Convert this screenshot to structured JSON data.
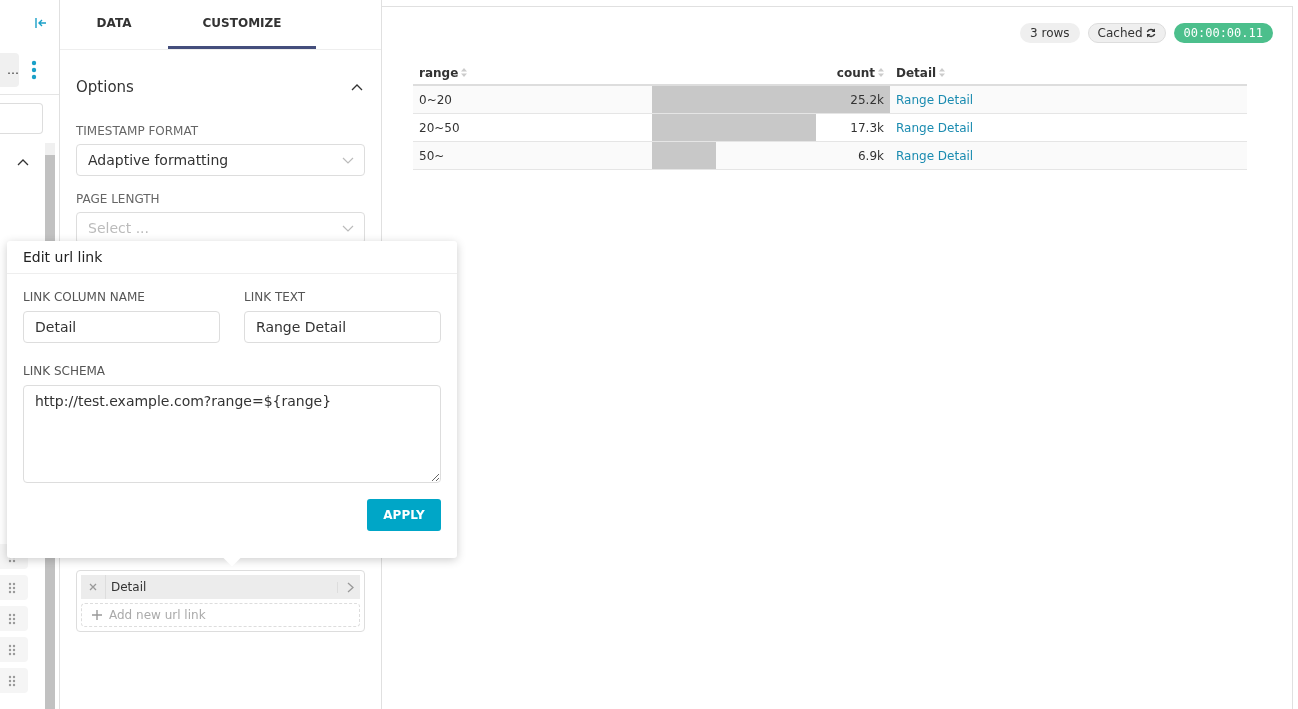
{
  "sidebar": {
    "menu_button": "…"
  },
  "panel": {
    "tabs": [
      {
        "label": "DATA",
        "selected": false
      },
      {
        "label": "CUSTOMIZE",
        "selected": true
      }
    ],
    "section": {
      "title": "Options",
      "expanded": true
    },
    "timestamp_format": {
      "label": "TIMESTAMP FORMAT",
      "value": "Adaptive formatting"
    },
    "page_length": {
      "label": "PAGE LENGTH",
      "placeholder": "Select ..."
    },
    "url_links": [
      {
        "label": "Detail"
      }
    ],
    "add_link": "Add new url link"
  },
  "popover": {
    "title": "Edit url link",
    "link_column_name": {
      "label": "LINK COLUMN NAME",
      "value": "Detail"
    },
    "link_text": {
      "label": "LINK TEXT",
      "value": "Range Detail"
    },
    "link_schema": {
      "label": "LINK SCHEMA",
      "value": "http://test.example.com?range=${range}"
    },
    "apply": "APPLY"
  },
  "status": {
    "rows": "3 rows",
    "cached": "Cached",
    "duration": "00:00:00.11"
  },
  "table": {
    "columns": [
      "range",
      "count",
      "Detail"
    ],
    "rows": [
      {
        "range": "0~20",
        "count": "25.2k",
        "level": 1,
        "detail": "Range Detail"
      },
      {
        "range": "20~50",
        "count": "17.3k",
        "level": 0.69,
        "detail": "Range Detail"
      },
      {
        "range": "50~",
        "count": "6.9k",
        "level": 0.27,
        "detail": "Range Detail"
      }
    ]
  }
}
